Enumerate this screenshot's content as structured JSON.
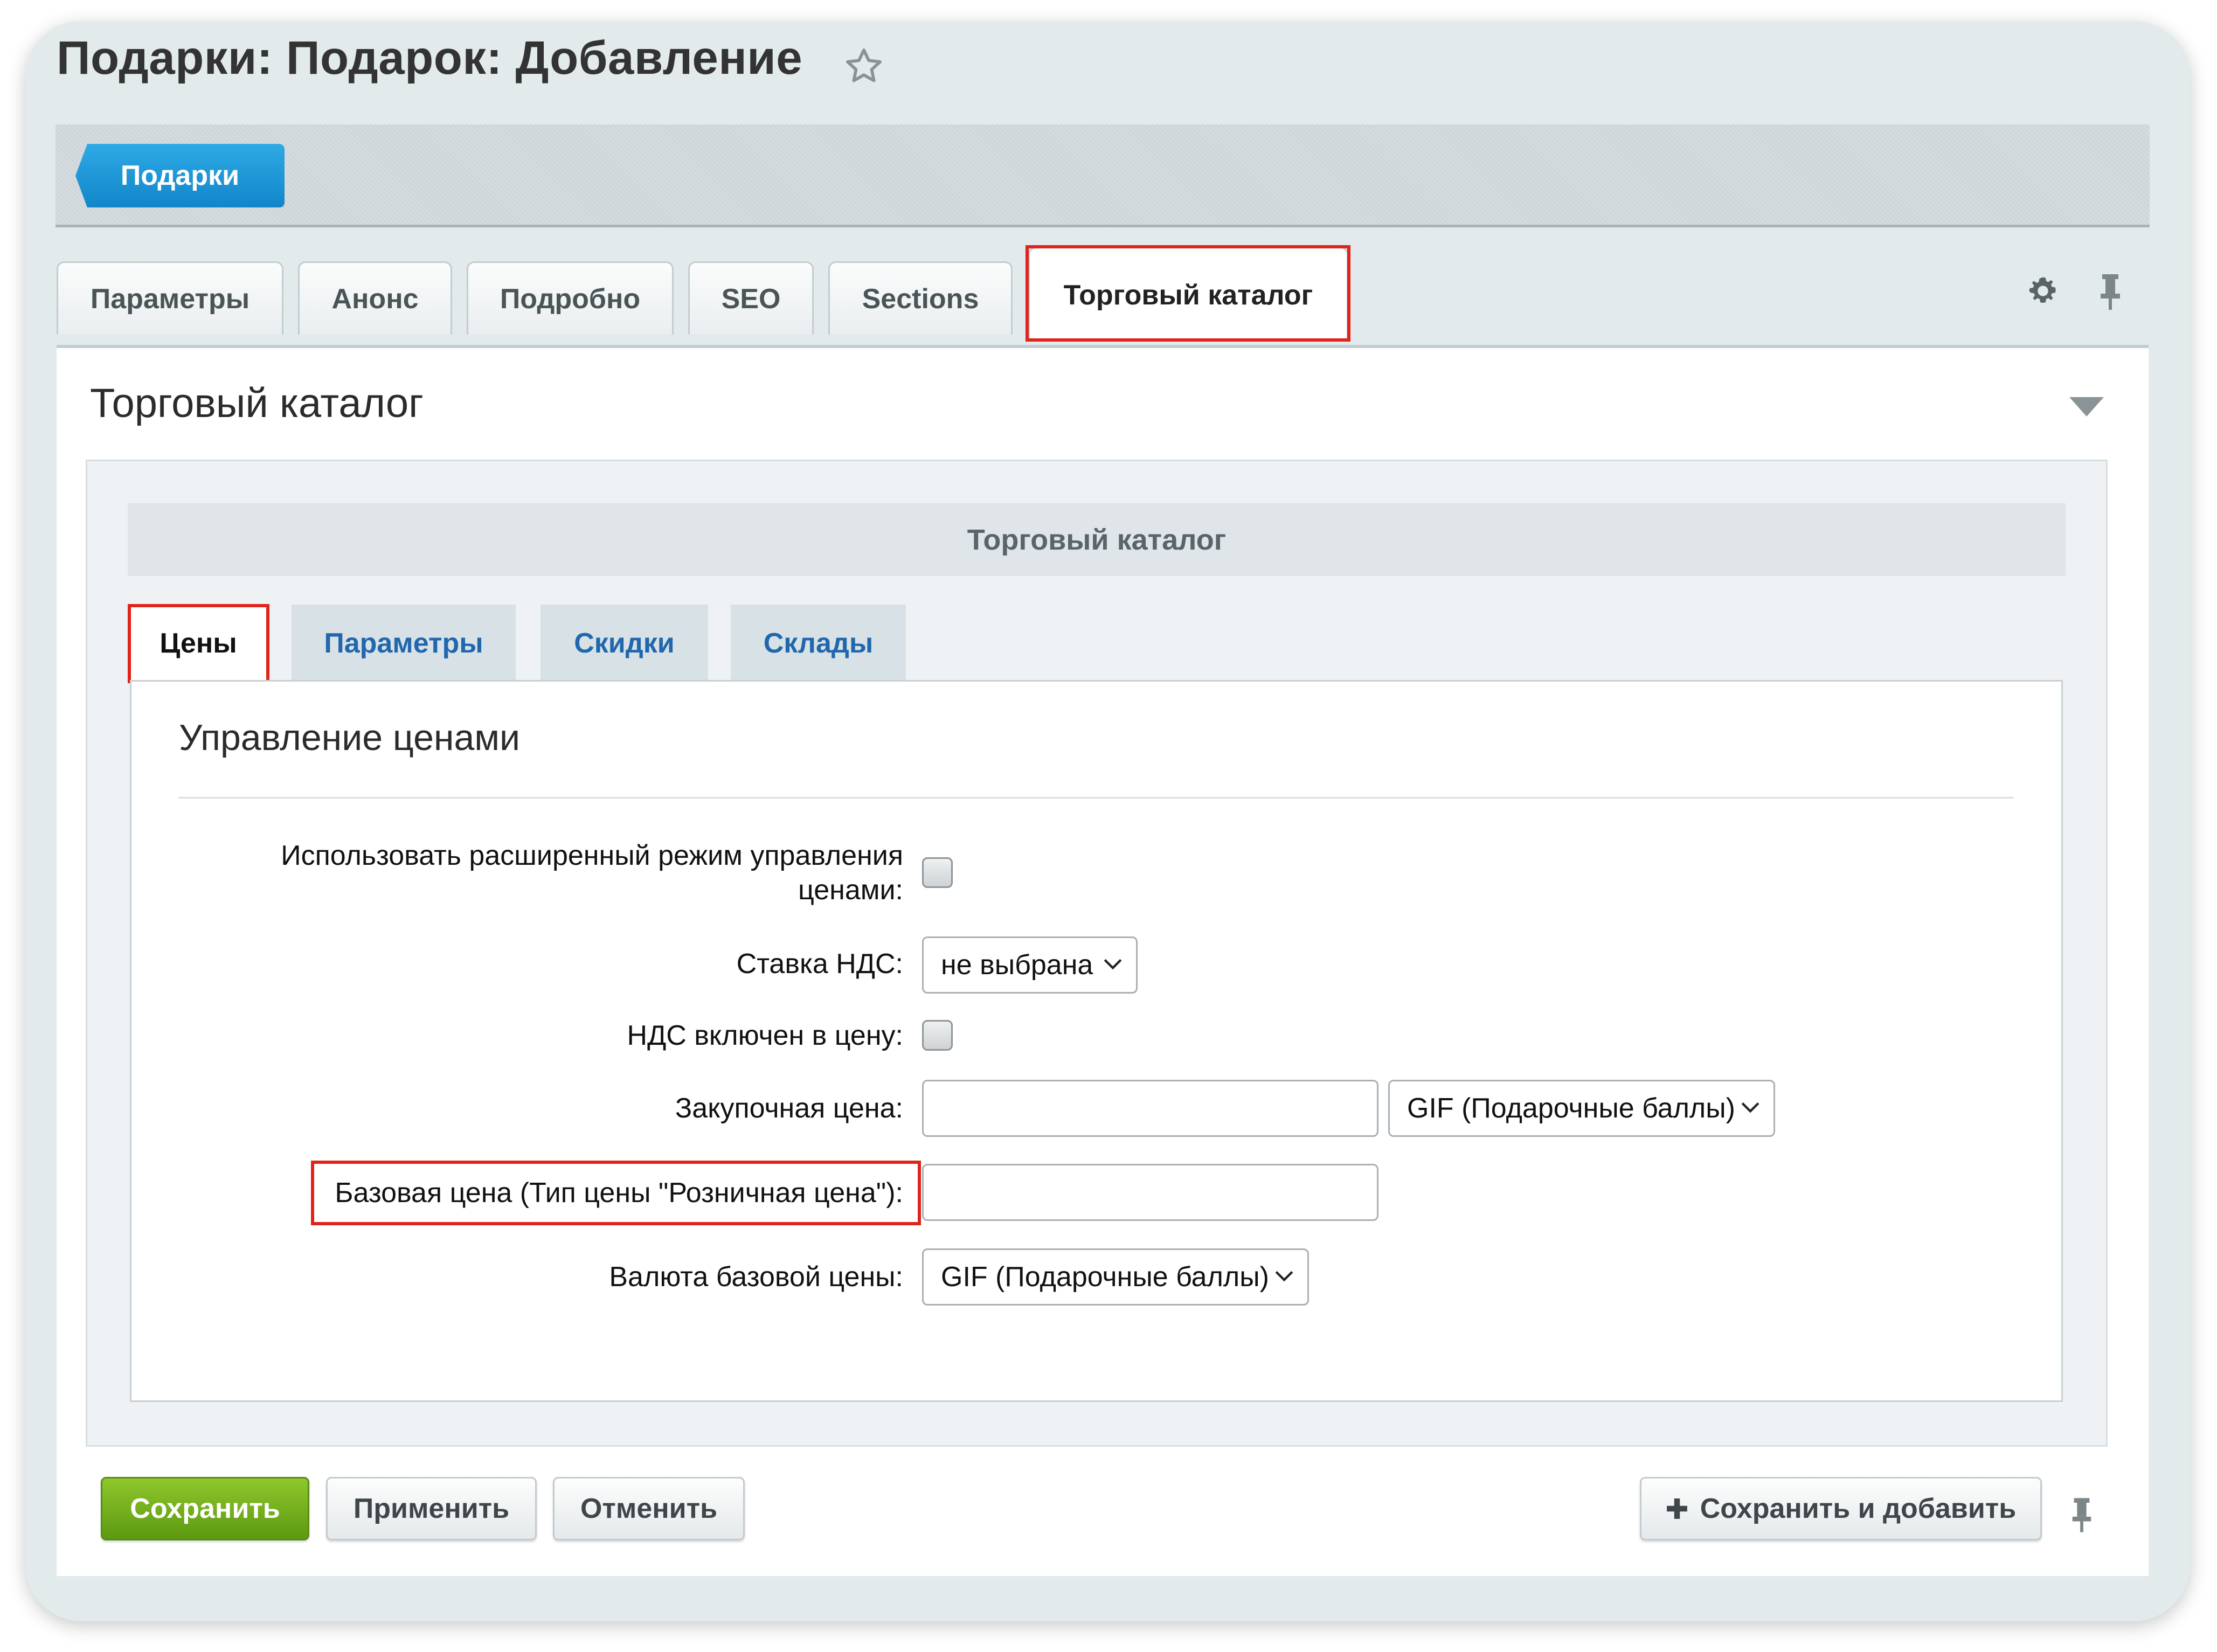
{
  "header": {
    "title": "Подарки: Подарок: Добавление",
    "back_chip": "Подарки"
  },
  "tabs": [
    {
      "label": "Параметры"
    },
    {
      "label": "Анонс"
    },
    {
      "label": "Подробно"
    },
    {
      "label": "SEO"
    },
    {
      "label": "Sections"
    },
    {
      "label": "Торговый каталог",
      "active": true
    }
  ],
  "section": {
    "title": "Торговый каталог",
    "inner_title": "Торговый каталог"
  },
  "subtabs": [
    {
      "label": "Цены",
      "active": true
    },
    {
      "label": "Параметры"
    },
    {
      "label": "Скидки"
    },
    {
      "label": "Склады"
    }
  ],
  "panel": {
    "title": "Управление ценами"
  },
  "fields": {
    "advanced_mode": {
      "label_line1": "Использовать расширенный режим управления",
      "label_line2": "ценами:",
      "checked": false
    },
    "vat_rate": {
      "label": "Ставка НДС:",
      "value": "не выбрана"
    },
    "vat_included": {
      "label": "НДС включен в цену:",
      "checked": false
    },
    "purchase_price": {
      "label": "Закупочная цена:",
      "value": "",
      "currency": "GIF (Подарочные баллы)"
    },
    "base_price": {
      "label": "Базовая цена (Тип цены \"Розничная цена\"):",
      "value": ""
    },
    "base_currency": {
      "label": "Валюта базовой цены:",
      "value": "GIF (Подарочные баллы)"
    }
  },
  "footer": {
    "save": "Сохранить",
    "apply": "Применить",
    "cancel": "Отменить",
    "save_and_add": "Сохранить и добавить"
  },
  "colors": {
    "highlight": "#e0241b",
    "accent_blue": "#1a8fd3",
    "primary_green": "#6aa817",
    "link_blue": "#2167ae"
  },
  "icons": [
    "star-icon",
    "gear-icon",
    "pin-icon",
    "collapse-arrow-icon",
    "chevron-down-icon",
    "plus-icon"
  ]
}
